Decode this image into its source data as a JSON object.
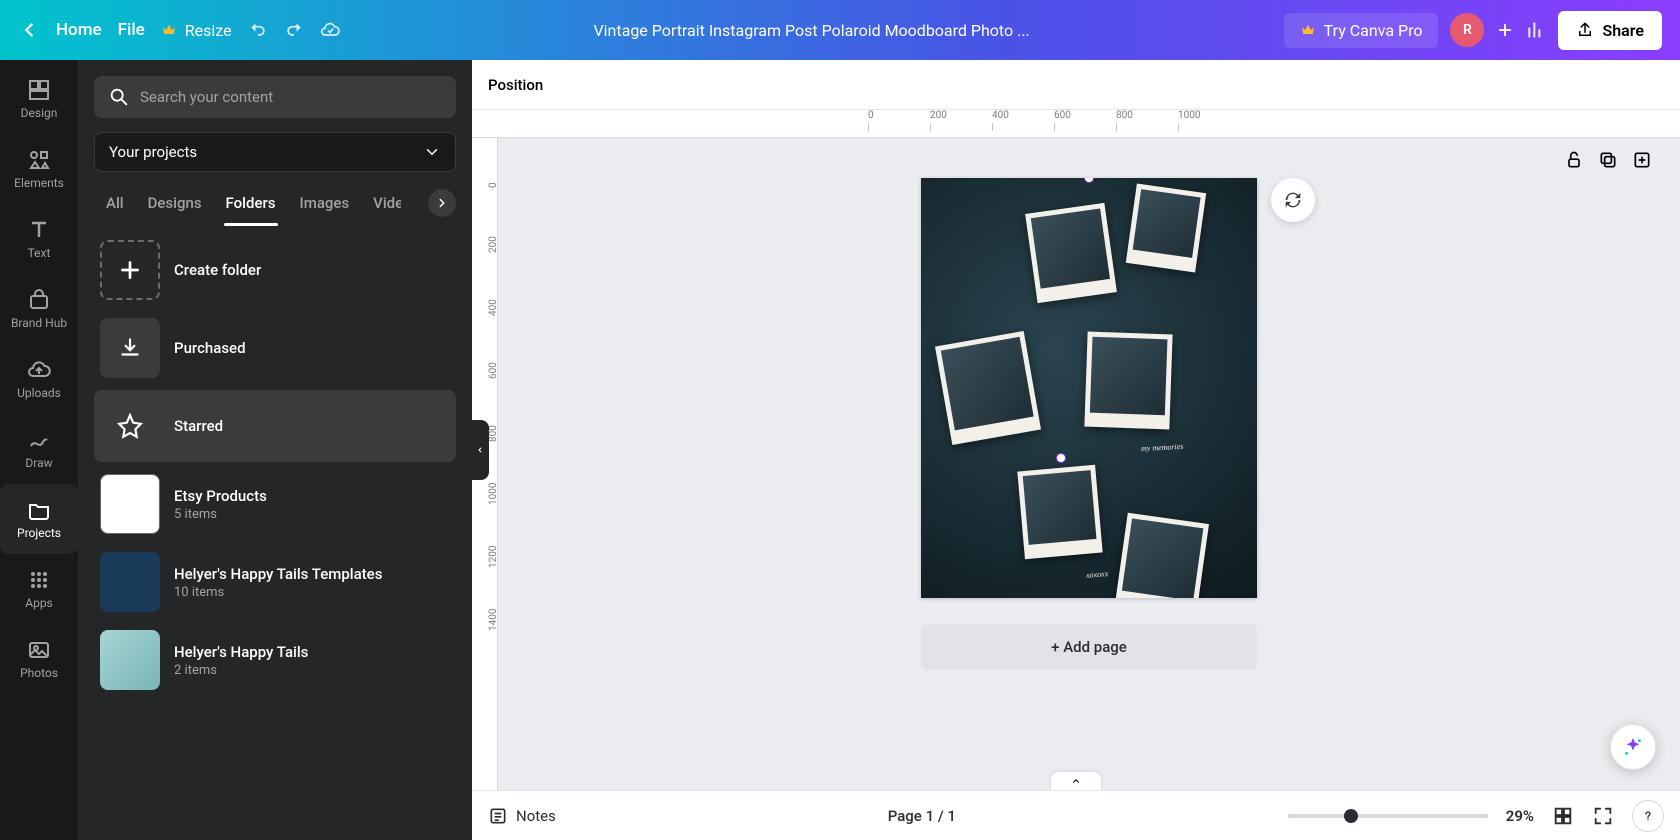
{
  "topbar": {
    "home": "Home",
    "file": "File",
    "resize": "Resize",
    "doc_title": "Vintage Portrait Instagram Post Polaroid Moodboard Photo ...",
    "try_pro": "Try Canva Pro",
    "avatar_initial": "R",
    "share": "Share"
  },
  "rail": {
    "items": [
      {
        "label": "Design"
      },
      {
        "label": "Elements"
      },
      {
        "label": "Text"
      },
      {
        "label": "Brand Hub"
      },
      {
        "label": "Uploads"
      },
      {
        "label": "Draw"
      },
      {
        "label": "Projects"
      },
      {
        "label": "Apps"
      },
      {
        "label": "Photos"
      }
    ]
  },
  "panel": {
    "search_placeholder": "Search your content",
    "filter_label": "Your projects",
    "tabs": [
      "All",
      "Designs",
      "Folders",
      "Images",
      "Videos"
    ],
    "create_folder": "Create folder",
    "folders": [
      {
        "name": "Purchased",
        "meta": ""
      },
      {
        "name": "Starred",
        "meta": ""
      },
      {
        "name": "Etsy Products",
        "meta": "5 items"
      },
      {
        "name": "Helyer's Happy Tails Templates",
        "meta": "10 items"
      },
      {
        "name": "Helyer's Happy Tails",
        "meta": "2 items"
      }
    ]
  },
  "toolbar": {
    "position": "Position"
  },
  "ruler": {
    "h_ticks": [
      "0",
      "200",
      "400",
      "600",
      "800",
      "1000"
    ],
    "v_ticks": [
      "0",
      "200",
      "400",
      "600",
      "800",
      "1000",
      "1200",
      "1400"
    ]
  },
  "artboard": {
    "handwriting1": "my memories",
    "handwriting2": "xoxoxx"
  },
  "add_page": "+ Add page",
  "bottombar": {
    "notes": "Notes",
    "page_indicator": "Page 1 / 1",
    "zoom": "29%"
  }
}
